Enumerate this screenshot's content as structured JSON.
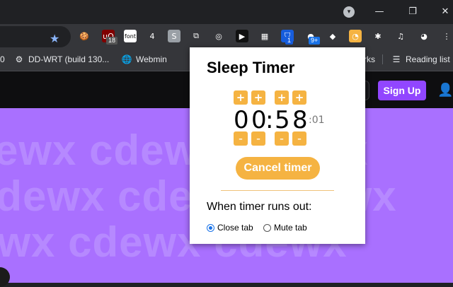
{
  "browser": {
    "window_controls": {
      "minimize": "—",
      "restore": "❐",
      "close": "✕"
    },
    "extensions": [
      {
        "name": "cookie-extension-icon",
        "glyph": "🍪",
        "bg": "#35363a"
      },
      {
        "name": "ublock-extension-icon",
        "glyph": "uO",
        "bg": "#800000",
        "badge": "18",
        "badge_bg": "#555"
      },
      {
        "name": "font-extension-icon",
        "glyph": "font",
        "bg": "#ffffff"
      },
      {
        "name": "dice-extension-icon",
        "glyph": "4",
        "bg": "#35363a"
      },
      {
        "name": "s-extension-icon",
        "glyph": "S",
        "bg": "#9aa0a6"
      },
      {
        "name": "copy-extension-icon",
        "glyph": "⧉",
        "bg": "#35363a"
      },
      {
        "name": "circle-extension-icon",
        "glyph": "◎",
        "bg": "#35363a"
      },
      {
        "name": "play-extension-icon",
        "glyph": "▶",
        "bg": "#111"
      },
      {
        "name": "chip-extension-icon",
        "glyph": "▦",
        "bg": "#35363a"
      },
      {
        "name": "bitwarden-extension-icon",
        "glyph": "⛉",
        "bg": "#175ddc",
        "badge": "1",
        "badge_bg": "#175ddc"
      },
      {
        "name": "green-dot-extension-icon",
        "glyph": "●",
        "bg": "#35363a",
        "badge": "9+",
        "badge_bg": "#1a73e8"
      },
      {
        "name": "gem-extension-icon",
        "glyph": "◆",
        "bg": "#35363a"
      },
      {
        "name": "sleep-timer-extension-icon",
        "glyph": "◔",
        "bg": "#f5b342"
      },
      {
        "name": "puzzle-extension-icon",
        "glyph": "✱",
        "bg": "#35363a"
      },
      {
        "name": "media-control-icon",
        "glyph": "♫",
        "bg": "#35363a"
      },
      {
        "name": "incognito-avatar-icon",
        "glyph": "◕",
        "bg": "#35363a"
      },
      {
        "name": "menu-kebab-icon",
        "glyph": "⋮",
        "bg": "#35363a"
      }
    ],
    "bookmarks": [
      {
        "label": "DD-WRT (build 130...",
        "icon": "dd-wrt-icon",
        "glyph": "⚙"
      },
      {
        "label": "Webmin",
        "icon": "globe-icon",
        "glyph": "🌐"
      },
      {
        "label": "rks",
        "icon": "",
        "glyph": ""
      },
      {
        "label": "Reading list",
        "icon": "reading-list-icon",
        "glyph": "☰"
      }
    ],
    "bookmark_partial": "0"
  },
  "page": {
    "signup_label": "Sign Up",
    "background_word": "cdewx",
    "colors": {
      "purple": "#a970ff",
      "accent": "#9146ff"
    }
  },
  "popup": {
    "title": "Sleep Timer",
    "plus": "+",
    "minus": "–",
    "hours_tens": "0",
    "hours_ones": "0",
    "colon": ":",
    "minutes_tens": "5",
    "minutes_ones": "8",
    "seconds": ":01",
    "cancel_label": "Cancel timer",
    "when_label": "When timer runs out:",
    "options": [
      {
        "label": "Close tab",
        "selected": true
      },
      {
        "label": "Mute tab",
        "selected": false
      }
    ],
    "accent": "#f5b342"
  }
}
